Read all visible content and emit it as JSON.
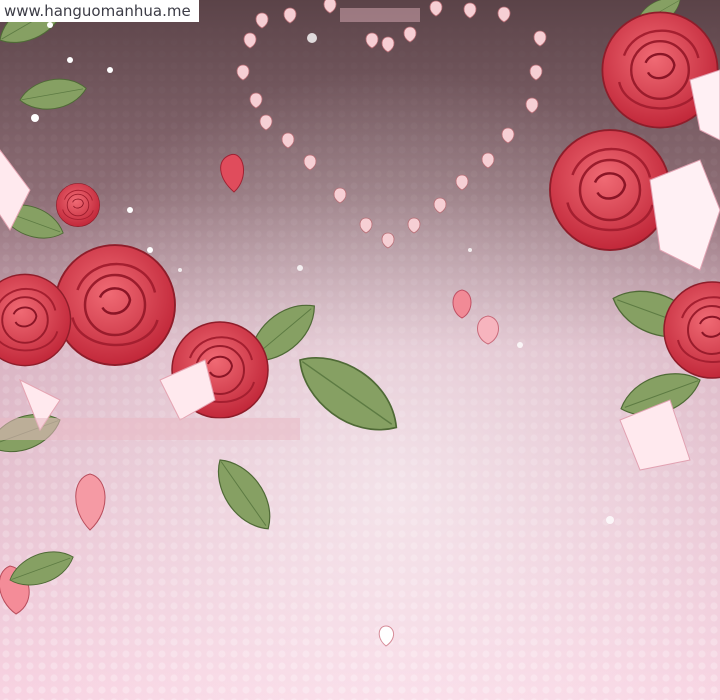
{
  "watermark": {
    "text": "www.hanguomanhua.me"
  },
  "palette": {
    "sky_top": "#5b4348",
    "sky_mid": "#b7929c",
    "sky_bottom": "#f7cfe0",
    "rose_dark": "#c9303f",
    "rose_light": "#ef5a68",
    "leaf": "#7f9a5b",
    "petal": "#f2c2c8"
  }
}
